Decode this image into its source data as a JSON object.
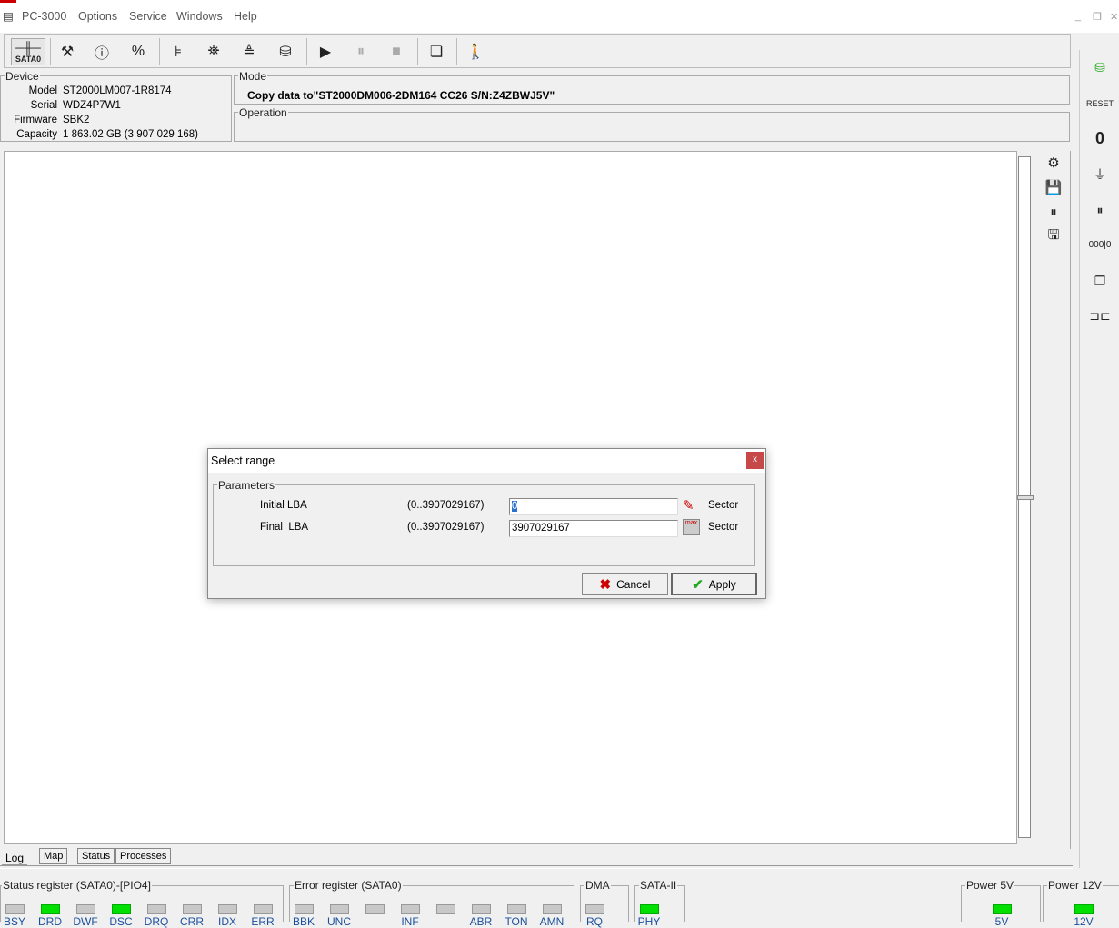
{
  "menu": {
    "app": "PC-3000",
    "items": [
      "Options",
      "Service",
      "Windows",
      "Help"
    ]
  },
  "toolbar": {
    "port": "SATA0"
  },
  "device": {
    "label": "Device",
    "rows": [
      {
        "k": "Model",
        "v": "ST2000LM007-1R8174"
      },
      {
        "k": "Serial",
        "v": "WDZ4P7W1"
      },
      {
        "k": "Firmware",
        "v": "SBK2"
      },
      {
        "k": "Capacity",
        "v": "1 863.02 GB (3 907 029 168)"
      }
    ]
  },
  "mode": {
    "label": "Mode",
    "text": "Copy data to\"ST2000DM006-2DM164 CC26 S/N:Z4ZBWJ5V\""
  },
  "operation": {
    "label": "Operation"
  },
  "tabs": [
    "Log",
    "Map",
    "Status",
    "Processes"
  ],
  "dialog": {
    "title": "Select range",
    "close": "x",
    "group": "Parameters",
    "rows": [
      {
        "label": "Initial LBA",
        "range": "(0..3907029167)",
        "value": "0",
        "unit": "Sector"
      },
      {
        "label": "Final  LBA",
        "range": "(0..3907029167)",
        "value": "3907029167",
        "unit": "Sector"
      }
    ],
    "cancel": "Cancel",
    "apply": "Apply"
  },
  "status": {
    "status_reg": {
      "label": "Status register (SATA0)-[PIO4]",
      "leds": [
        {
          "n": "BSY",
          "on": false
        },
        {
          "n": "DRD",
          "on": true
        },
        {
          "n": "DWF",
          "on": false
        },
        {
          "n": "DSC",
          "on": true
        },
        {
          "n": "DRQ",
          "on": false
        },
        {
          "n": "CRR",
          "on": false
        },
        {
          "n": "IDX",
          "on": false
        },
        {
          "n": "ERR",
          "on": false
        }
      ]
    },
    "error_reg": {
      "label": "Error register (SATA0)",
      "leds": [
        {
          "n": "BBK",
          "on": false
        },
        {
          "n": "UNC",
          "on": false
        },
        {
          "n": "",
          "on": false
        },
        {
          "n": "INF",
          "on": false
        },
        {
          "n": "",
          "on": false
        },
        {
          "n": "ABR",
          "on": false
        },
        {
          "n": "TON",
          "on": false
        },
        {
          "n": "AMN",
          "on": false
        }
      ]
    },
    "dma": {
      "label": "DMA",
      "leds": [
        {
          "n": "RQ",
          "on": false
        }
      ]
    },
    "sata": {
      "label": "SATA-II",
      "leds": [
        {
          "n": "PHY",
          "on": true
        }
      ]
    },
    "p5": {
      "label": "Power 5V",
      "leds": [
        {
          "n": "5V",
          "on": true
        }
      ]
    },
    "p12": {
      "label": "Power 12V",
      "leds": [
        {
          "n": "12V",
          "on": true
        }
      ]
    }
  },
  "colors": {
    "led_on": "#00e000",
    "led_off": "#c8c8c8",
    "label_blue": "#1a4f9c"
  }
}
